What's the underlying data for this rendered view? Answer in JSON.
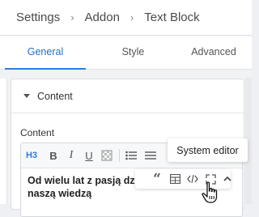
{
  "breadcrumb": {
    "items": [
      "Settings",
      "Addon",
      "Text Block"
    ],
    "separator": "›"
  },
  "tabs": [
    {
      "label": "General",
      "active": true
    },
    {
      "label": "Style",
      "active": false
    },
    {
      "label": "Advanced",
      "active": false
    }
  ],
  "section": {
    "title": "Content",
    "expanded": true
  },
  "field": {
    "label": "Content",
    "value": "Od wielu lat z pasją dz naszą wiedzą"
  },
  "editor_toolbar": {
    "heading": "H3",
    "bold": "B",
    "italic": "I",
    "underline": "U",
    "icons": [
      "clear-format-icon",
      "bullet-list-icon",
      "more-icon"
    ]
  },
  "floating_toolbar": {
    "icons": [
      "quote-icon",
      "table-icon",
      "code-icon",
      "expand-icon",
      "collapse-up-icon"
    ]
  },
  "tooltip": {
    "text": "System editor"
  },
  "colors": {
    "accent": "#2c7be5",
    "active_tab_text": "#2470c7",
    "panel_bg": "#f1f2f4"
  }
}
